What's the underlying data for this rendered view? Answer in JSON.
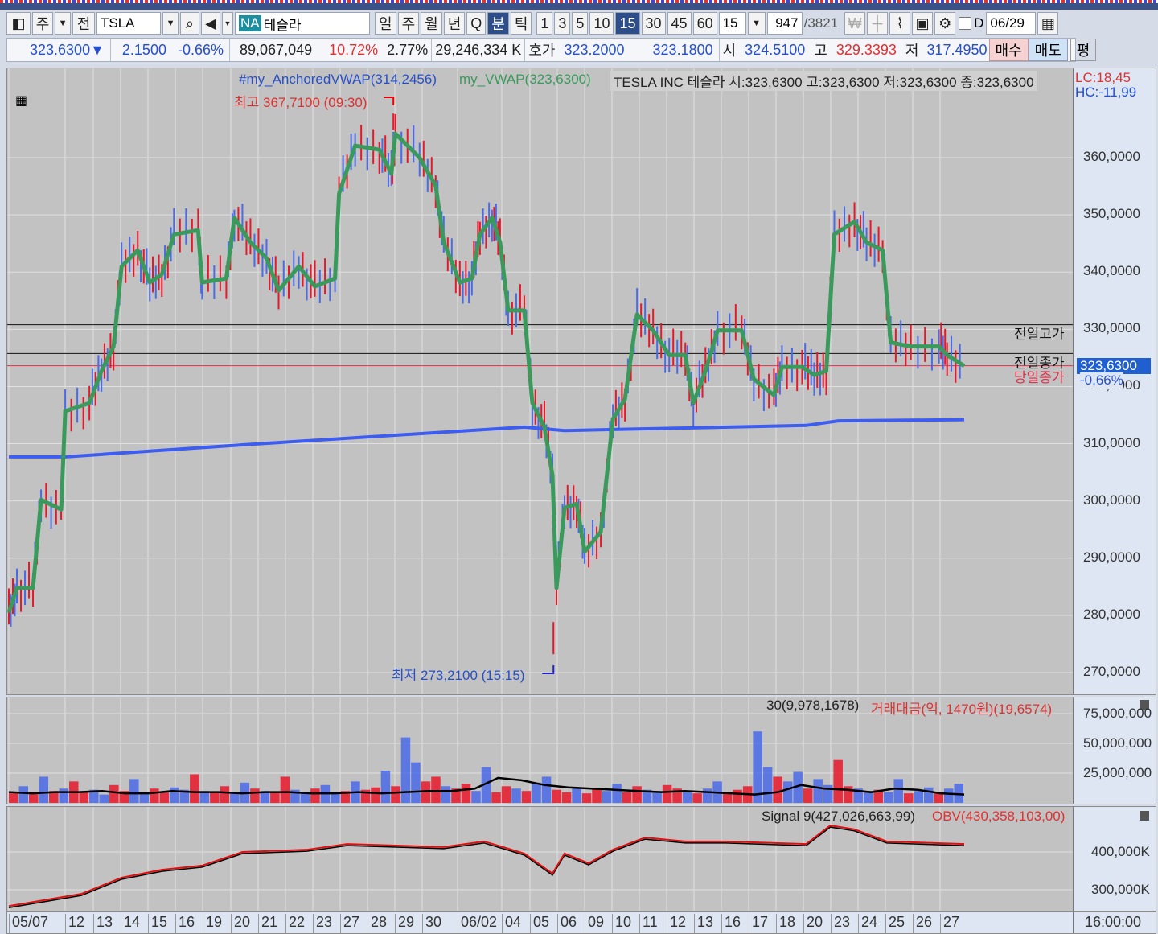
{
  "toolbar": {
    "market": "주",
    "prev": "전",
    "symbol": "TSLA",
    "exchange_badge": "NA",
    "name": "테슬라",
    "periods": [
      "일",
      "주",
      "월",
      "년",
      "Q",
      "분",
      "틱"
    ],
    "selected_period": "분",
    "minutes": [
      "1",
      "3",
      "5",
      "10",
      "15",
      "30",
      "45",
      "60"
    ],
    "selected_minute": "15",
    "interval_value": "15",
    "count": "947",
    "total": "/3821",
    "d_label": "D",
    "date": "06/29"
  },
  "quote": {
    "price": "323.6300",
    "arrow": "▼",
    "change": "2.1500",
    "change_pct": "-0.66%",
    "volume": "89,067,049",
    "turnover_pct": "10.72%",
    "pct2": "2.77%",
    "amount": "29,246,334 K",
    "hoga_label": "호가",
    "ask": "323.2000",
    "bid": "323.1800",
    "open_label": "시",
    "open": "324.5100",
    "high_label": "고",
    "high": "329.3393",
    "low_label": "저",
    "low": "317.4950",
    "buy": "매수",
    "sell": "매도",
    "avg": "평"
  },
  "price_panel": {
    "legend_avwap": "#my_AnchoredVWAP(314,2456)",
    "legend_vwap": "my_VWAP(323,6300)",
    "info": "TESLA INC  테슬라 시:323,6300 고:323,6300 저:323,6300 종:323,6300",
    "lc": "LC:18,45",
    "hc": "HC:-11,99",
    "high_marker": "최고 367,7100 (09:30)",
    "low_marker": "최저 273,2100 (15:15)",
    "ref_prev_high": "전일고가",
    "ref_prev_close": "전일종가",
    "ref_today_close": "당일종가",
    "current_tag": "323,6300",
    "current_pct": "-0,66%",
    "ticks": [
      "360,0000",
      "350,0000",
      "340,0000",
      "330,0000",
      "320,0000",
      "310,0000",
      "300,0000",
      "290,0000",
      "280,0000",
      "270,0000"
    ]
  },
  "volume_panel": {
    "legend_ma": "30(9,978,1678)",
    "legend_amount": "거래대금(억, 1470원)(19,6574)",
    "ticks": [
      "75,000,000",
      "50,000,000",
      "25,000,000"
    ]
  },
  "obv_panel": {
    "legend_signal": "Signal 9(427,026,663,99)",
    "legend_obv": "OBV(430,358,103,00)",
    "ticks": [
      "400,000K",
      "300,000K"
    ]
  },
  "xaxis": {
    "labels": [
      "05/07",
      "12",
      "13",
      "14",
      "15",
      "16",
      "19",
      "20",
      "21",
      "22",
      "23",
      "27",
      "28",
      "29",
      "30",
      "06/02",
      "04",
      "05",
      "06",
      "09",
      "10",
      "11",
      "12",
      "13",
      "16",
      "17",
      "18",
      "20",
      "23",
      "24",
      "25",
      "26",
      "27"
    ],
    "time": "16:00:00"
  },
  "colors": {
    "vwap": "#3a9a5c",
    "avwap": "#3d5cf0",
    "up": "#e8182a",
    "down": "#4a6ae8",
    "ref_today": "#e0304a"
  },
  "chart_data": {
    "type": "line",
    "title": "TSLA 15분",
    "ylim": [
      266,
      371
    ],
    "x_unit": "bar",
    "xlim": [
      0,
      949
    ],
    "series": [
      {
        "name": "my_VWAP",
        "points": [
          [
            0,
            280.5
          ],
          [
            8,
            284.8
          ],
          [
            24,
            284.8
          ],
          [
            32,
            300.2
          ],
          [
            52,
            298.5
          ],
          [
            56,
            315.7
          ],
          [
            80,
            317.1
          ],
          [
            92,
            322.7
          ],
          [
            104,
            327
          ],
          [
            112,
            341
          ],
          [
            128,
            343.8
          ],
          [
            140,
            338.2
          ],
          [
            152,
            339.6
          ],
          [
            164,
            346.6
          ],
          [
            188,
            347.3
          ],
          [
            192,
            338.2
          ],
          [
            216,
            338.9
          ],
          [
            224,
            349.5
          ],
          [
            240,
            345.2
          ],
          [
            256,
            342.4
          ],
          [
            268,
            336.8
          ],
          [
            288,
            341
          ],
          [
            304,
            337.5
          ],
          [
            324,
            338.9
          ],
          [
            328,
            353.7
          ],
          [
            344,
            362.1
          ],
          [
            368,
            361.4
          ],
          [
            380,
            357.2
          ],
          [
            384,
            364.2
          ],
          [
            408,
            360
          ],
          [
            424,
            355.1
          ],
          [
            432,
            345.2
          ],
          [
            448,
            338.2
          ],
          [
            460,
            338.9
          ],
          [
            468,
            346.6
          ],
          [
            480,
            349.5
          ],
          [
            488,
            345.2
          ],
          [
            496,
            333.3
          ],
          [
            512,
            333.3
          ],
          [
            520,
            317.1
          ],
          [
            532,
            312.9
          ],
          [
            540,
            304.5
          ],
          [
            544,
            284.8
          ],
          [
            552,
            298.8
          ],
          [
            564,
            299.5
          ],
          [
            572,
            291.1
          ],
          [
            588,
            294.6
          ],
          [
            600,
            314.3
          ],
          [
            612,
            317.8
          ],
          [
            624,
            332.6
          ],
          [
            640,
            329.8
          ],
          [
            656,
            325.5
          ],
          [
            672,
            325.5
          ],
          [
            680,
            317.1
          ],
          [
            692,
            322.7
          ],
          [
            704,
            329.8
          ],
          [
            728,
            329.8
          ],
          [
            740,
            321.3
          ],
          [
            760,
            318.5
          ],
          [
            768,
            323.4
          ],
          [
            788,
            323.4
          ],
          [
            800,
            322
          ],
          [
            812,
            322.7
          ],
          [
            820,
            346.6
          ],
          [
            840,
            348.8
          ],
          [
            852,
            345.2
          ],
          [
            868,
            343.8
          ],
          [
            876,
            327.7
          ],
          [
            896,
            327
          ],
          [
            924,
            327
          ],
          [
            932,
            325.5
          ],
          [
            949,
            323.6
          ]
        ]
      },
      {
        "name": "my_AnchoredVWAP",
        "points": [
          [
            0,
            307.7
          ],
          [
            56,
            307.7
          ],
          [
            232,
            309.8
          ],
          [
            512,
            312.9
          ],
          [
            552,
            312.3
          ],
          [
            792,
            313.2
          ],
          [
            824,
            314
          ],
          [
            949,
            314.2
          ]
        ]
      }
    ],
    "reference_lines": {
      "전일고가": 330.8,
      "전일종가": 325.78,
      "당일종가": 323.63
    },
    "annotations": {
      "high": {
        "bar": 382,
        "value": 367.71,
        "time": "09:30"
      },
      "low": {
        "bar": 541,
        "value": 273.21,
        "time": "15:15"
      }
    },
    "volume": {
      "ylim": [
        0,
        85000000
      ],
      "values_m": [
        8,
        14,
        9,
        22,
        10,
        12,
        18,
        9,
        11,
        7,
        15,
        10,
        20,
        8,
        12,
        9,
        13,
        11,
        24,
        10,
        9,
        14,
        8,
        17,
        12,
        10,
        9,
        22,
        11,
        8,
        12,
        15,
        9,
        10,
        18,
        11,
        13,
        27,
        14,
        55,
        34,
        18,
        22,
        14,
        12,
        16,
        10,
        30,
        9,
        14,
        12,
        10,
        17,
        22,
        11,
        9,
        13,
        8,
        12,
        10,
        16,
        9,
        14,
        11,
        10,
        15,
        12,
        9,
        8,
        12,
        18,
        9,
        11,
        14,
        60,
        30,
        22,
        18,
        26,
        12,
        20,
        15,
        36,
        14,
        12,
        10,
        11,
        9,
        20,
        8,
        10,
        13,
        9,
        12,
        16
      ],
      "dirs": "udududuudduudduudduduudduduuddudduduududduuduudduududduuduudduudduududduuudduddudduuddudduddudd",
      "ma30_m": [
        9,
        8,
        9,
        9,
        10,
        8,
        8,
        10,
        9,
        9,
        8,
        9,
        9,
        8,
        8,
        9,
        8,
        9,
        10,
        10,
        12,
        21,
        19,
        15,
        13,
        12,
        11,
        10,
        9,
        10,
        9,
        8,
        7,
        9,
        15,
        12,
        11,
        9,
        12,
        11,
        8,
        7
      ]
    },
    "obv": {
      "unit": "K",
      "points": [
        [
          0,
          257000
        ],
        [
          72,
          289000
        ],
        [
          112,
          332000
        ],
        [
          152,
          353000
        ],
        [
          192,
          364000
        ],
        [
          232,
          400000
        ],
        [
          296,
          406000
        ],
        [
          336,
          421000
        ],
        [
          432,
          413000
        ],
        [
          472,
          428000
        ],
        [
          512,
          396000
        ],
        [
          540,
          343000
        ],
        [
          552,
          396000
        ],
        [
          576,
          370000
        ],
        [
          600,
          406000
        ],
        [
          632,
          438000
        ],
        [
          672,
          428000
        ],
        [
          712,
          428000
        ],
        [
          792,
          421000
        ],
        [
          816,
          470000
        ],
        [
          840,
          460000
        ],
        [
          872,
          428000
        ],
        [
          949,
          421000
        ]
      ]
    }
  }
}
